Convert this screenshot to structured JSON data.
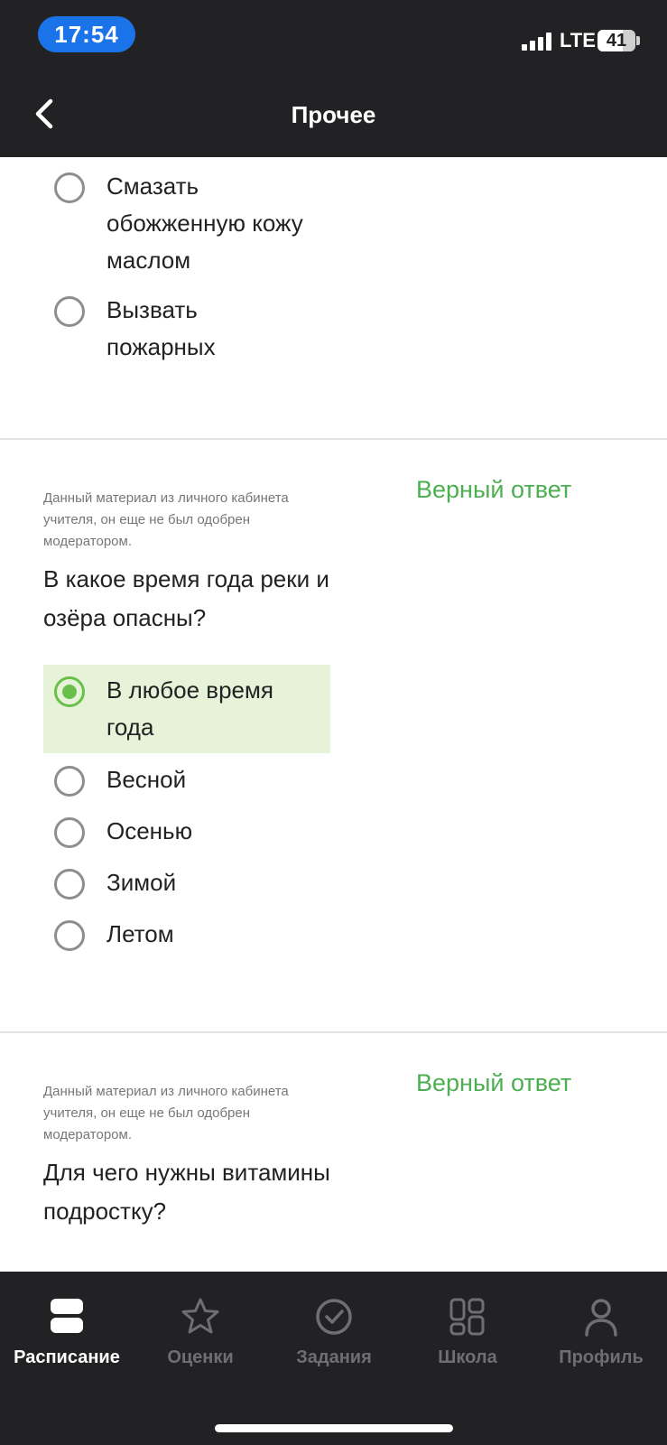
{
  "status_bar": {
    "time": "17:54",
    "network": "LTE",
    "battery": "41"
  },
  "nav": {
    "title": "Прочее"
  },
  "question_prev": {
    "options": [
      {
        "label": "Смазать обожженную кожу маслом",
        "selected": false
      },
      {
        "label": "Вызвать пожарных",
        "selected": false
      }
    ]
  },
  "question_1": {
    "note": "Данный материал из личного кабинета учителя, он еще не был одобрен модератором.",
    "correct_label": "Верный ответ",
    "text": "В какое время года реки и озёра опасны?",
    "options": [
      {
        "label": "В любое время года",
        "selected": true
      },
      {
        "label": "Весной",
        "selected": false
      },
      {
        "label": "Осенью",
        "selected": false
      },
      {
        "label": "Зимой",
        "selected": false
      },
      {
        "label": "Летом",
        "selected": false
      }
    ]
  },
  "question_2": {
    "note": "Данный материал из личного кабинета учителя, он еще не был одобрен модератором.",
    "correct_label": "Верный ответ",
    "text": "Для чего нужны витамины подростку?"
  },
  "tabbar": {
    "tabs": [
      {
        "label": "Расписание",
        "icon": "schedule-icon",
        "active": true
      },
      {
        "label": "Оценки",
        "icon": "star-icon",
        "active": false
      },
      {
        "label": "Задания",
        "icon": "check-circle-icon",
        "active": false
      },
      {
        "label": "Школа",
        "icon": "grid-icon",
        "active": false
      },
      {
        "label": "Профиль",
        "icon": "profile-icon",
        "active": false
      }
    ]
  },
  "colors": {
    "bar_bg": "#222224",
    "accent_green": "#4caf50",
    "selected_bg": "#e6f3d9",
    "time_pill": "#1a73e8"
  }
}
